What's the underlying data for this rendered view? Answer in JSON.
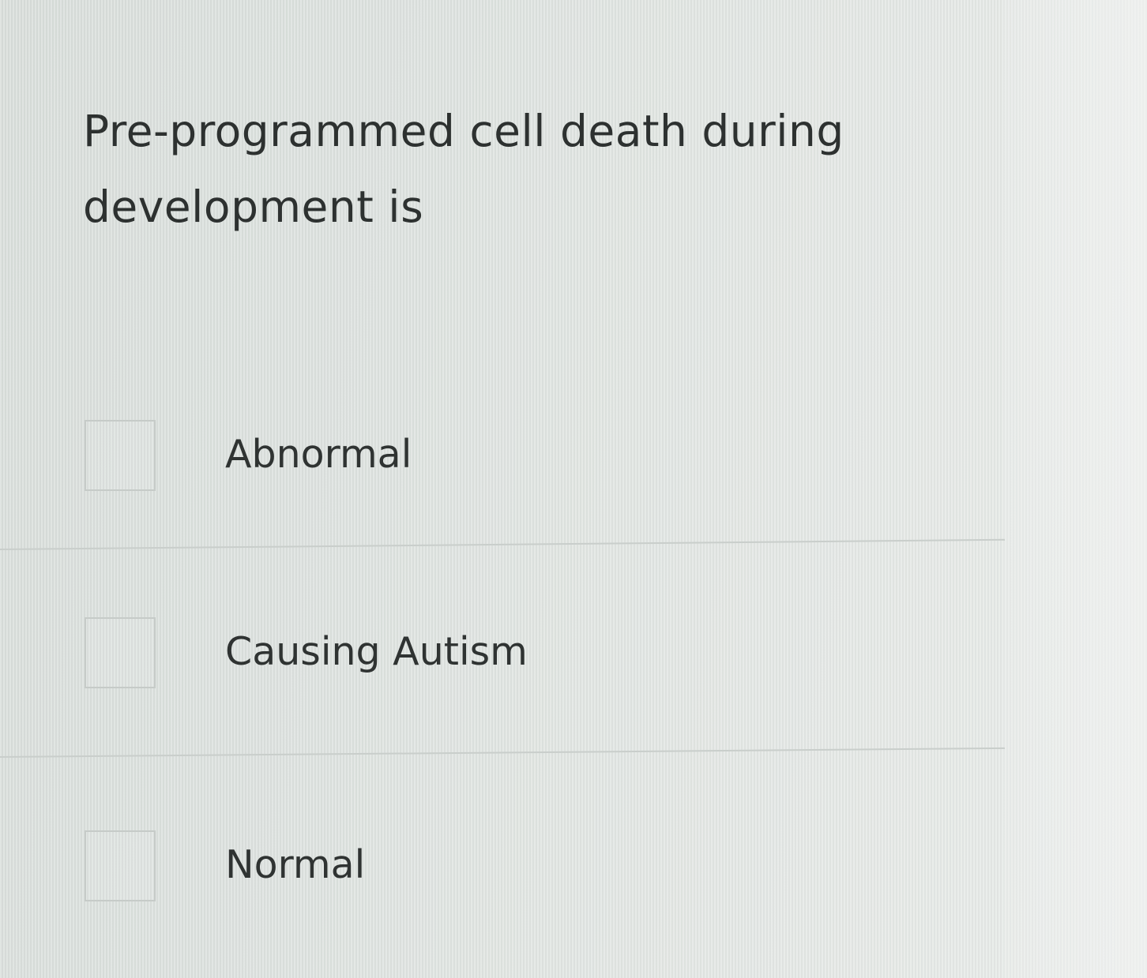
{
  "question": {
    "line1": "Pre-programmed cell death during",
    "line2": "development is"
  },
  "options": [
    {
      "label": "Abnormal",
      "checked": false
    },
    {
      "label": "Causing Autism",
      "checked": false
    },
    {
      "label": "Normal",
      "checked": false
    }
  ]
}
